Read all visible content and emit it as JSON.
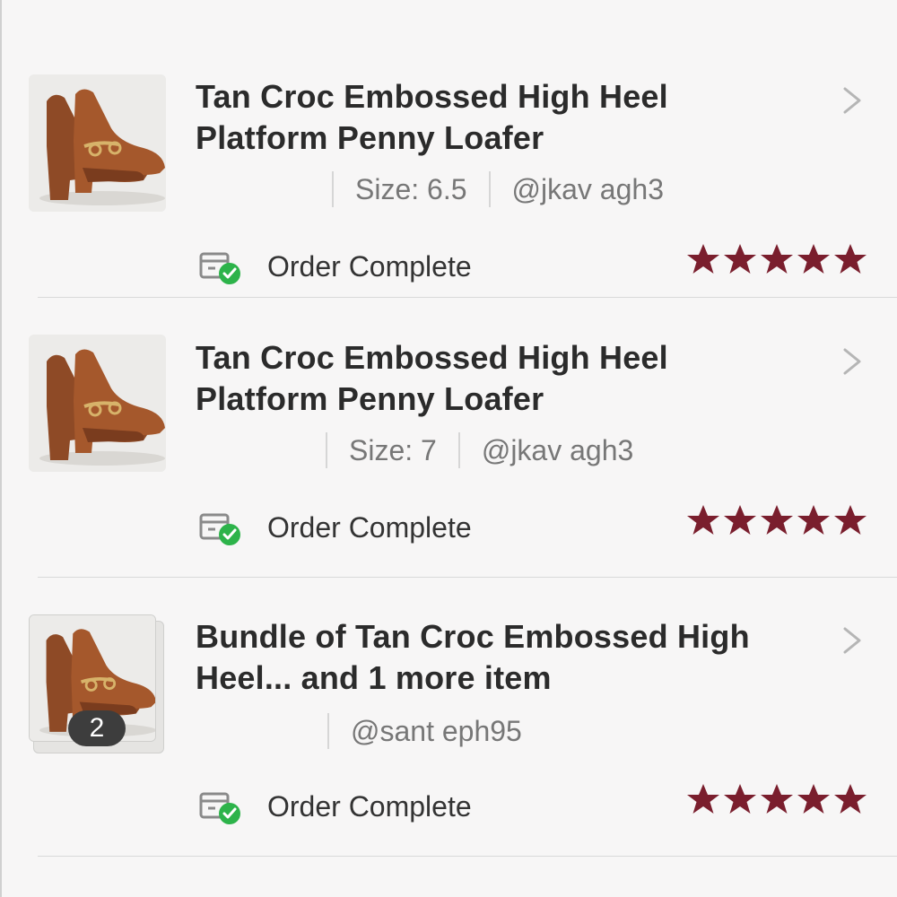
{
  "colors": {
    "star": "#7a1e2d",
    "check": "#2db34a",
    "chevron": "#b5b5b5",
    "badge": "#3d3d3d"
  },
  "orders": [
    {
      "title": "Tan Croc Embossed High Heel Platform Penny Loafer",
      "size": "Size: 6.5",
      "username": "@jkav   agh3",
      "status": "Order Complete",
      "rating": 5,
      "bundle_count": null
    },
    {
      "title": "Tan Croc Embossed High Heel Platform Penny Loafer",
      "size": "Size: 7",
      "username": "@jkav   agh3",
      "status": "Order Complete",
      "rating": 5,
      "bundle_count": null
    },
    {
      "title": "Bundle of Tan Croc Embossed High Heel... and 1 more item",
      "size": "",
      "username": "@sant     eph95",
      "status": "Order Complete",
      "rating": 5,
      "bundle_count": "2"
    }
  ],
  "icons": {
    "chevron": "chevron-right-icon",
    "status": "package-check-icon",
    "star": "star-icon",
    "thumbnail": "shoe-thumbnail"
  }
}
